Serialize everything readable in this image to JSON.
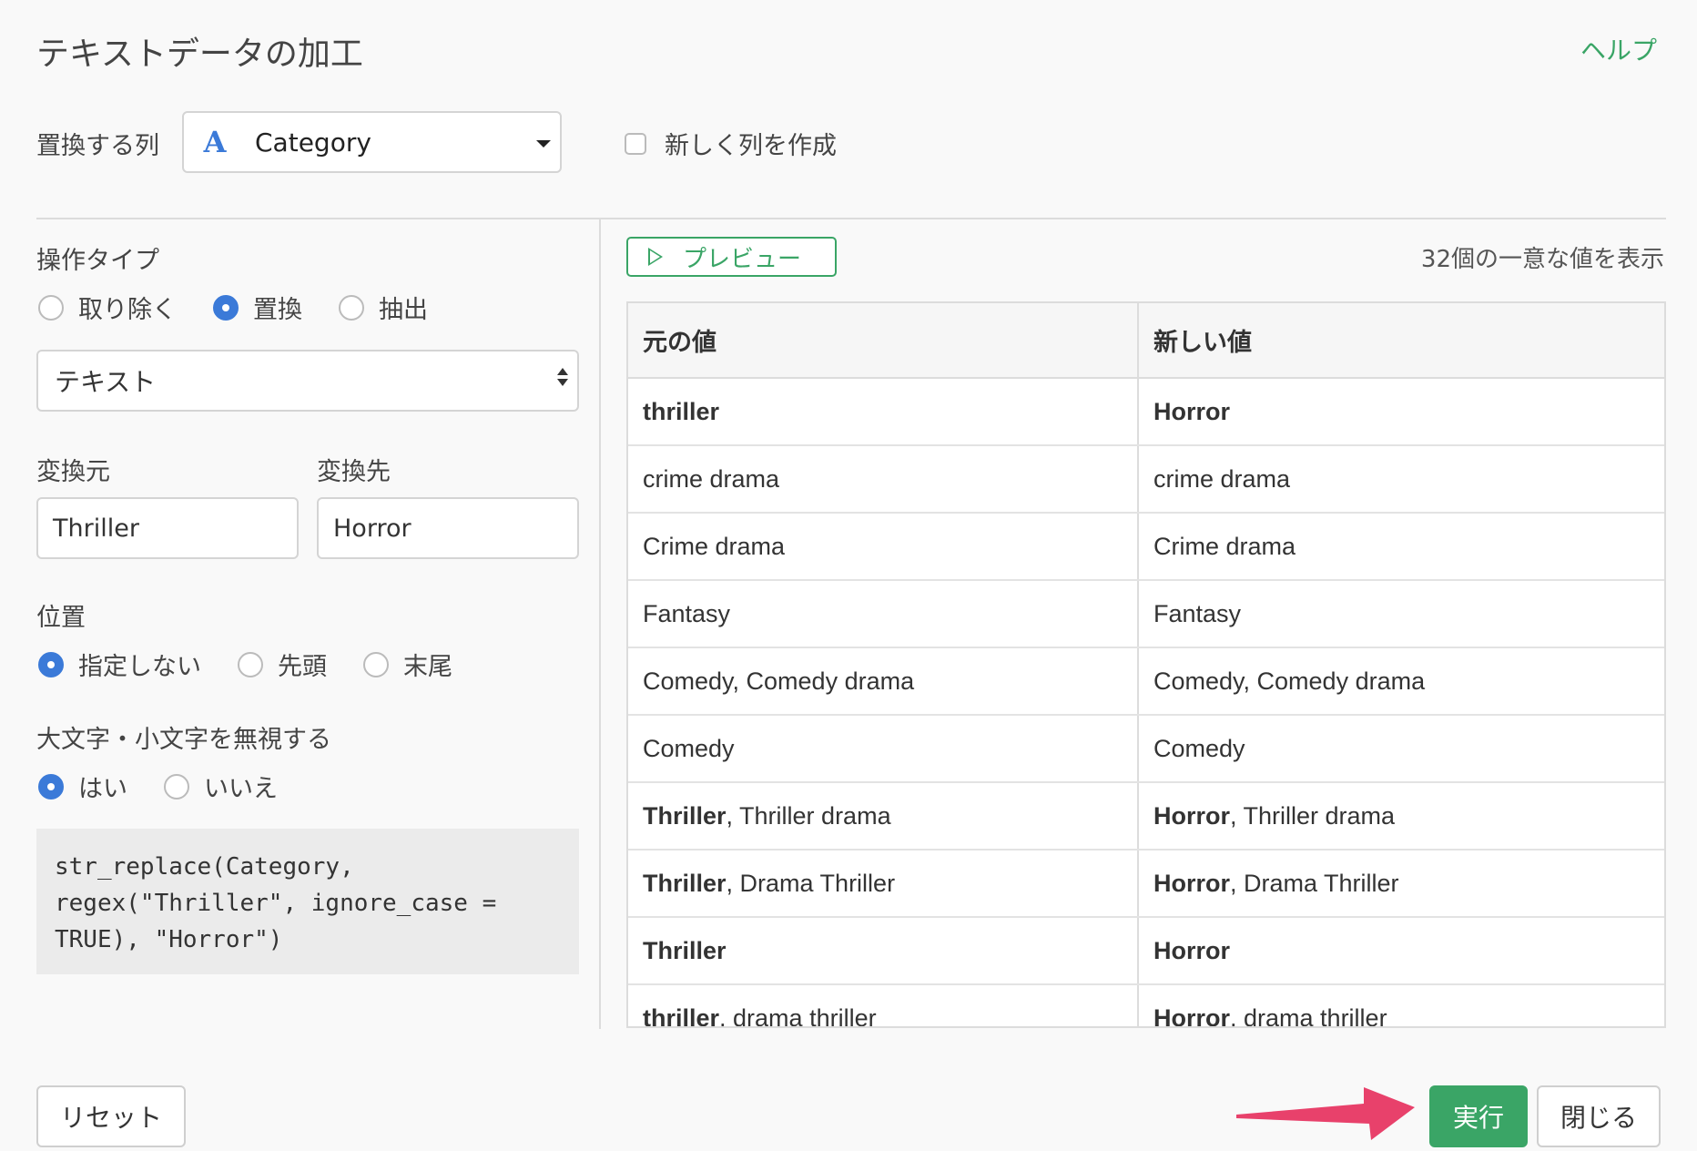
{
  "header": {
    "title": "テキストデータの加工",
    "help": "ヘルプ"
  },
  "column": {
    "label": "置換する列",
    "type_icon": "A",
    "value": "Category",
    "new_column_label": "新しく列を作成",
    "new_column_checked": false
  },
  "operation": {
    "label": "操作タイプ",
    "options": [
      "取り除く",
      "置換",
      "抽出"
    ],
    "selected": "置換"
  },
  "match_type": {
    "value": "テキスト"
  },
  "replace": {
    "from_label": "変換元",
    "from_value": "Thriller",
    "to_label": "変換先",
    "to_value": "Horror"
  },
  "position": {
    "label": "位置",
    "options": [
      "指定しない",
      "先頭",
      "末尾"
    ],
    "selected": "指定しない"
  },
  "ignore_case": {
    "label": "大文字・小文字を無視する",
    "options": [
      "はい",
      "いいえ"
    ],
    "selected": "はい"
  },
  "code": "str_replace(Category,\nregex(\"Thriller\", ignore_case =\nTRUE), \"Horror\")",
  "preview": {
    "button_label": "プレビュー",
    "count_text": "32個の一意な値を表示"
  },
  "table": {
    "headers": [
      "元の値",
      "新しい値"
    ],
    "rows": [
      {
        "orig_bold": "thriller",
        "orig_rest": "",
        "new_bold": "Horror",
        "new_rest": ""
      },
      {
        "orig_bold": "",
        "orig_rest": "crime drama",
        "new_bold": "",
        "new_rest": "crime drama"
      },
      {
        "orig_bold": "",
        "orig_rest": "Crime drama",
        "new_bold": "",
        "new_rest": "Crime drama"
      },
      {
        "orig_bold": "",
        "orig_rest": "Fantasy",
        "new_bold": "",
        "new_rest": "Fantasy"
      },
      {
        "orig_bold": "",
        "orig_rest": "Comedy, Comedy drama",
        "new_bold": "",
        "new_rest": "Comedy, Comedy drama"
      },
      {
        "orig_bold": "",
        "orig_rest": "Comedy",
        "new_bold": "",
        "new_rest": "Comedy"
      },
      {
        "orig_bold": "Thriller",
        "orig_rest": ", Thriller drama",
        "new_bold": "Horror",
        "new_rest": ", Thriller drama"
      },
      {
        "orig_bold": "Thriller",
        "orig_rest": ", Drama Thriller",
        "new_bold": "Horror",
        "new_rest": ", Drama Thriller"
      },
      {
        "orig_bold": "Thriller",
        "orig_rest": "",
        "new_bold": "Horror",
        "new_rest": ""
      },
      {
        "orig_bold": "thriller",
        "orig_rest": ", drama thriller",
        "new_bold": "Horror",
        "new_rest": ", drama thriller"
      }
    ]
  },
  "footer": {
    "reset": "リセット",
    "run": "実行",
    "close": "閉じる"
  },
  "colors": {
    "accent_green": "#3aa566",
    "radio_blue": "#3b7ad8",
    "arrow_pink": "#e8416b"
  }
}
